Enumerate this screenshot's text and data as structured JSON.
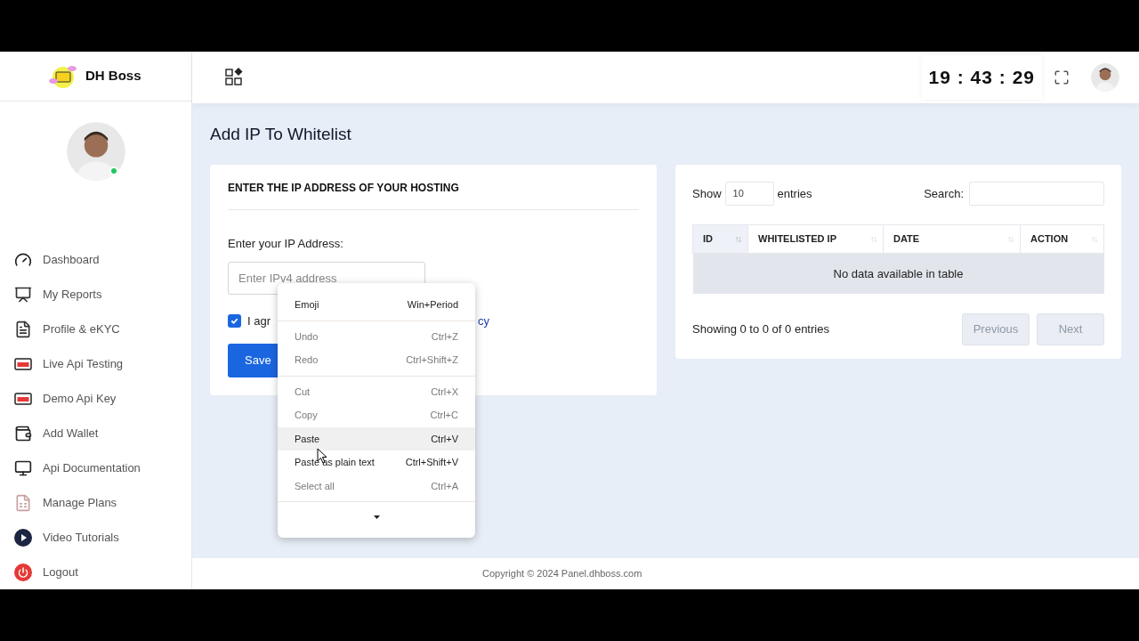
{
  "sidebar": {
    "brand": "DH Boss",
    "items": [
      {
        "label": "Dashboard"
      },
      {
        "label": "My Reports"
      },
      {
        "label": "Profile & eKYC"
      },
      {
        "label": "Live Api Testing"
      },
      {
        "label": "Demo Api Key"
      },
      {
        "label": "Add Wallet"
      },
      {
        "label": "Api Documentation"
      },
      {
        "label": "Manage Plans"
      },
      {
        "label": "Video Tutorials"
      },
      {
        "label": "Logout"
      }
    ]
  },
  "header": {
    "clock": "19 : 43 : 29"
  },
  "page": {
    "title": "Add IP To Whitelist"
  },
  "ip_form": {
    "heading": "ENTER THE IP ADDRESS OF YOUR HOSTING",
    "label": "Enter your IP Address:",
    "placeholder": "Enter IPv4 address",
    "agree": {
      "checked": true,
      "text_start": "I agr",
      "link_end": "cy"
    },
    "submit": "Save"
  },
  "table_card": {
    "length_before": "Show",
    "length_value": "10",
    "length_after": "entries",
    "search_label": "Search:",
    "columns": [
      {
        "label": "ID",
        "sorted": true
      },
      {
        "label": "WHITELISTED IP",
        "sorted": false
      },
      {
        "label": "DATE",
        "sorted": false
      },
      {
        "label": "ACTION",
        "sorted": false
      }
    ],
    "empty_message": "No data available in table",
    "info": "Showing 0 to 0 of 0 entries",
    "pagination": [
      {
        "label": "Previous",
        "disabled": true
      },
      {
        "label": "Next",
        "disabled": true
      }
    ]
  },
  "context_menu": {
    "groups": [
      [
        {
          "label": "Emoji",
          "shortcut": "Win+Period",
          "disabled": false,
          "selected": false
        }
      ],
      [
        {
          "label": "Undo",
          "shortcut": "Ctrl+Z",
          "disabled": true,
          "selected": false
        },
        {
          "label": "Redo",
          "shortcut": "Ctrl+Shift+Z",
          "disabled": true,
          "selected": false
        }
      ],
      [
        {
          "label": "Cut",
          "shortcut": "Ctrl+X",
          "disabled": true,
          "selected": false
        },
        {
          "label": "Copy",
          "shortcut": "Ctrl+C",
          "disabled": true,
          "selected": false
        },
        {
          "label": "Paste",
          "shortcut": "Ctrl+V",
          "disabled": false,
          "selected": true
        },
        {
          "label": "Paste as plain text",
          "shortcut": "Ctrl+Shift+V",
          "disabled": false,
          "selected": false
        },
        {
          "label": "Select all",
          "shortcut": "Ctrl+A",
          "disabled": true,
          "selected": false
        }
      ]
    ]
  },
  "footer": "Copyright © 2024 Panel.dhboss.com"
}
